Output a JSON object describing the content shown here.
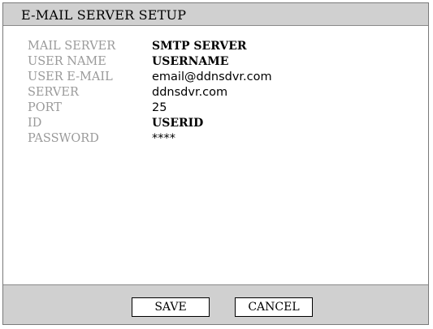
{
  "title": "E-MAIL SERVER SETUP",
  "fields": [
    {
      "label": "MAIL SERVER",
      "value": "SMTP SERVER"
    },
    {
      "label": "USER NAME",
      "value": "USERNAME"
    },
    {
      "label": "USER E-MAIL",
      "value": "email@ddnsdvr.com"
    },
    {
      "label": "SERVER",
      "value": "ddnsdvr.com"
    },
    {
      "label": "PORT",
      "value": "25"
    },
    {
      "label": "ID",
      "value": "USERID"
    },
    {
      "label": "PASSWORD",
      "value": "****"
    }
  ],
  "buttons": {
    "save": "SAVE",
    "cancel": "CANCEL"
  },
  "colors": {
    "title_bar": "#d0d0d0",
    "label_text": "#9a9a9a",
    "value_text": "#000000"
  }
}
